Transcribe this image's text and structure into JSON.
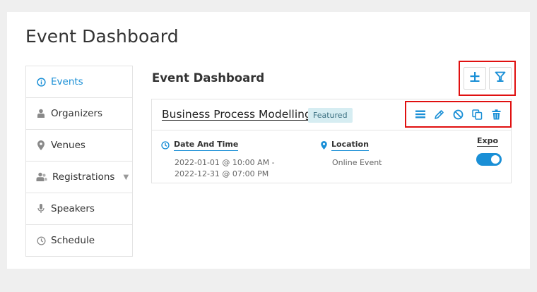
{
  "page": {
    "title": "Event Dashboard"
  },
  "sidebar": {
    "items": [
      {
        "label": "Events",
        "icon": "info-icon",
        "active": true
      },
      {
        "label": "Organizers",
        "icon": "user-icon"
      },
      {
        "label": "Venues",
        "icon": "map-pin-icon"
      },
      {
        "label": "Registrations",
        "icon": "users-icon",
        "has_dropdown": true
      },
      {
        "label": "Speakers",
        "icon": "microphone-icon"
      },
      {
        "label": "Schedule",
        "icon": "clock-icon"
      }
    ]
  },
  "main": {
    "title": "Event Dashboard",
    "top_actions": [
      {
        "name": "add-event",
        "icon": "plus-icon"
      },
      {
        "name": "filter",
        "icon": "filter-icon"
      }
    ]
  },
  "event": {
    "name": "Business Process Modelling",
    "badge": "Featured",
    "actions": [
      {
        "name": "list",
        "icon": "list-icon"
      },
      {
        "name": "edit",
        "icon": "pencil-icon"
      },
      {
        "name": "disable",
        "icon": "ban-icon"
      },
      {
        "name": "duplicate",
        "icon": "copy-icon"
      },
      {
        "name": "delete",
        "icon": "trash-icon"
      }
    ],
    "date_label": "Date And Time",
    "date_value": "2022-01-01 @ 10:00 AM - 2022-12-31 @ 07:00 PM",
    "location_label": "Location",
    "location_value": "Online Event",
    "expo_label": "Expo",
    "expo_enabled": true
  },
  "colors": {
    "accent": "#1a8fd6",
    "highlight_box": "#e01010",
    "badge_bg": "#d6edf2"
  }
}
